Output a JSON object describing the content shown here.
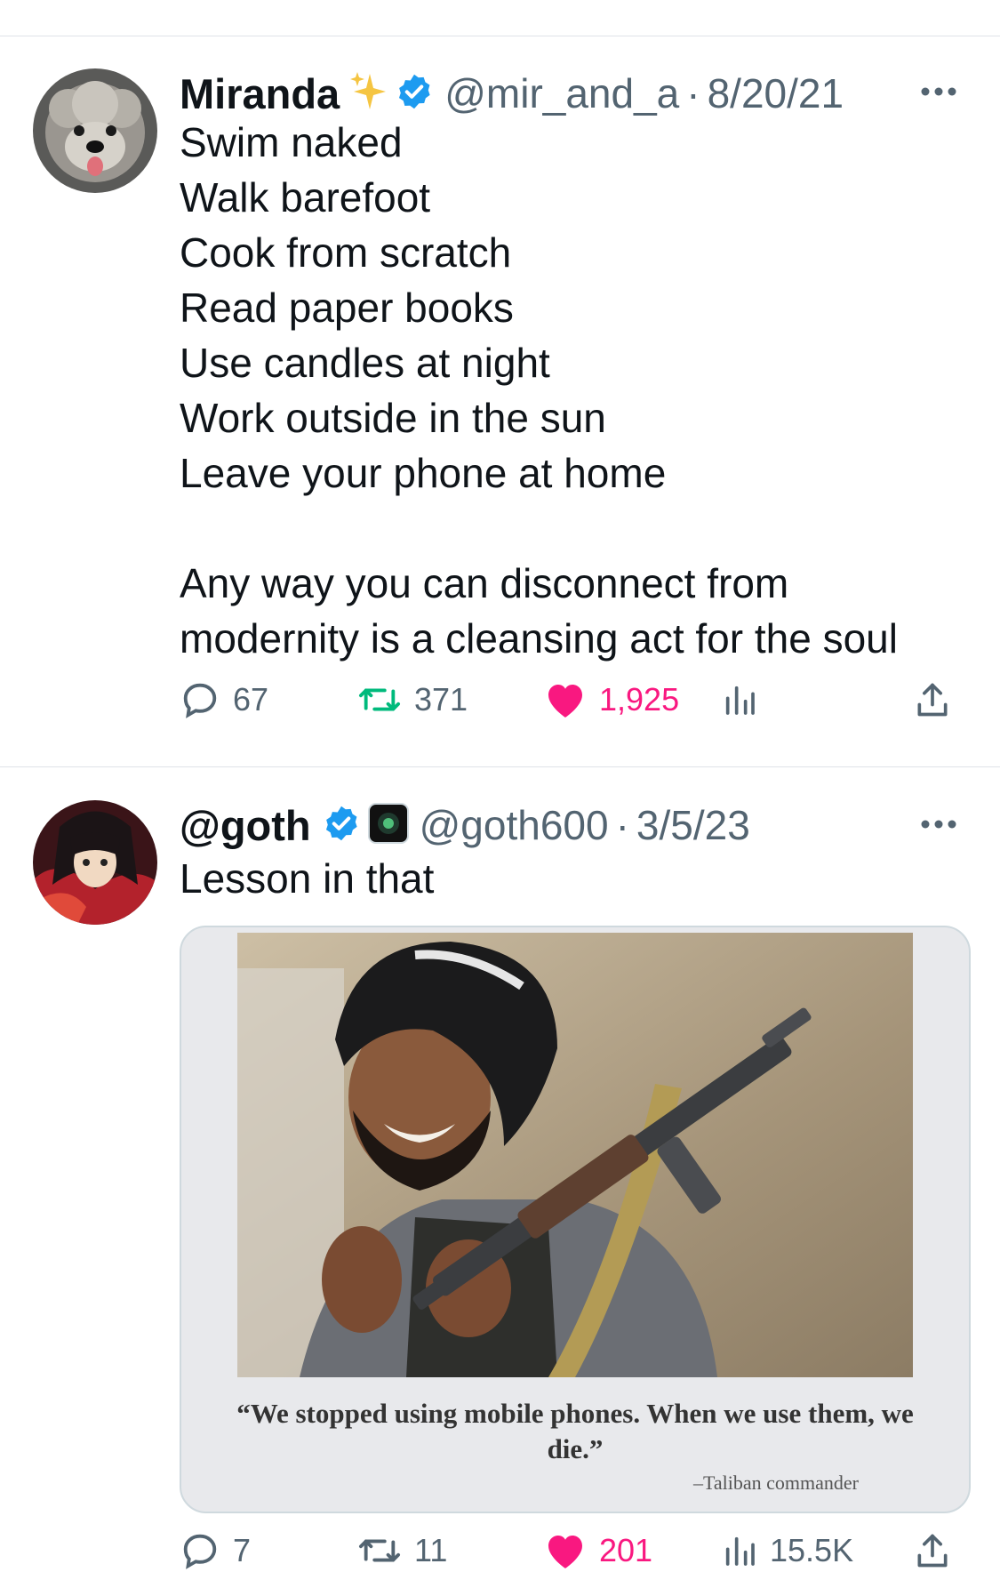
{
  "tweets": [
    {
      "name": "Miranda",
      "handle": "@mir_and_a",
      "separator": "·",
      "date": "8/20/21",
      "text": "Swim naked\nWalk barefoot\nCook from scratch\nRead paper books\nUse candles at night\nWork outside in the sun\nLeave your phone at home\n\nAny way you can disconnect from modernity is a cleansing act for the soul",
      "replies": "67",
      "retweets": "371",
      "likes": "1,925",
      "views": ""
    },
    {
      "name": "@goth",
      "handle": "@goth600",
      "separator": "·",
      "date": "3/5/23",
      "text": "Lesson in that",
      "media": {
        "quote": "“We stopped using mobile phones. When we use them, we die.”",
        "attribution": "–Taliban commander"
      },
      "replies": "7",
      "retweets": "11",
      "likes": "201",
      "views": "15.5K"
    }
  ],
  "icons": {
    "reply": "reply-icon",
    "retweet": "retweet-icon",
    "like": "heart-icon",
    "views": "views-icon",
    "share": "share-icon",
    "verified": "verified-badge-icon",
    "sparkle": "sparkle-icon",
    "more": "more-icon"
  },
  "colors": {
    "like": "#f91880",
    "retweet": "#00ba7c",
    "verified": "#1d9bf0",
    "secondary_text": "#536471"
  }
}
